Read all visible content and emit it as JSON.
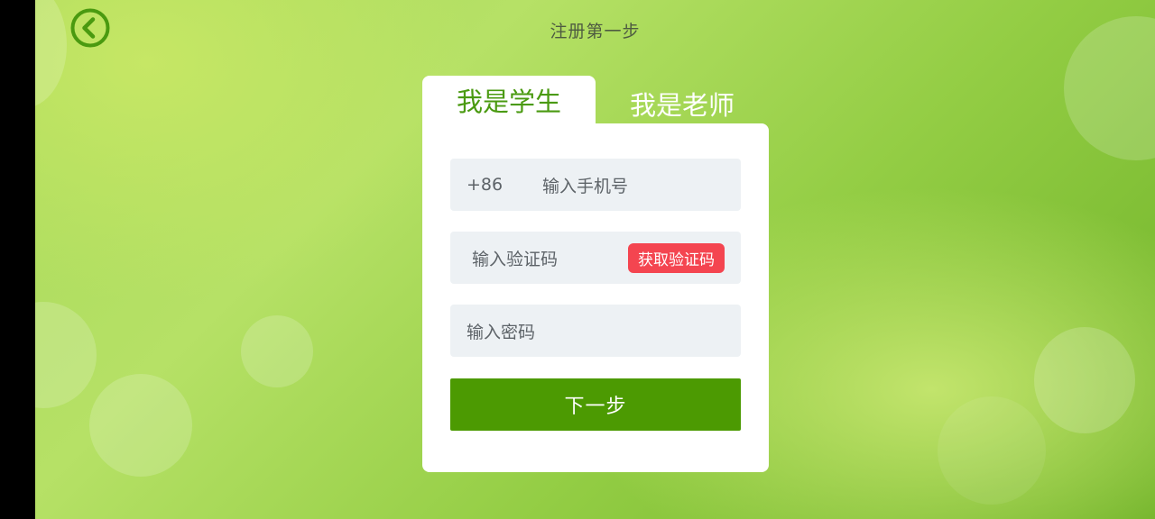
{
  "header": {
    "title": "注册第一步",
    "back_icon": "chevron-left-circle-icon"
  },
  "tabs": {
    "student_label": "我是学生",
    "teacher_label": "我是老师",
    "active": "student"
  },
  "form": {
    "country_code": "+86",
    "phone_placeholder": "输入手机号",
    "code_placeholder": "输入验证码",
    "get_code_label": "获取验证码",
    "password_placeholder": "输入密码",
    "next_label": "下一步"
  },
  "colors": {
    "accent_green": "#4c9a02",
    "get_code_red": "#f44550",
    "field_bg": "#edf1f4"
  }
}
